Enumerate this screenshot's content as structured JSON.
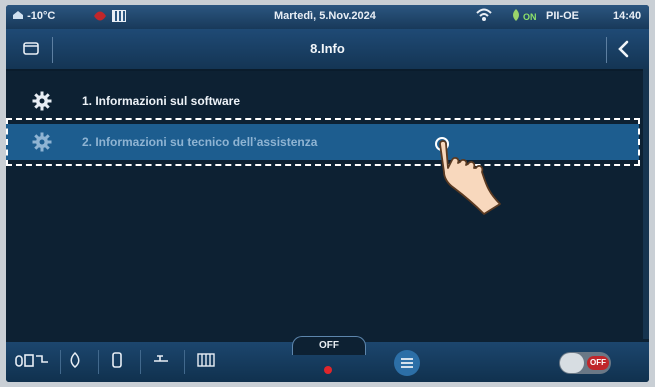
{
  "status_bar": {
    "temperature": "-10°C",
    "date": "Martedì, 5.Nov.2024",
    "on_label": "ON",
    "mode": "PII-OE",
    "time": "14:40"
  },
  "header": {
    "title": "8.Info"
  },
  "menu": {
    "items": [
      {
        "label": "1.  Informazioni sul software"
      },
      {
        "label": "2.  Informazioni su tecnico dell’assistenza"
      }
    ]
  },
  "bottom_bar": {
    "off_label": "OFF",
    "toggle_label": "OFF"
  },
  "colors": {
    "background": "#0d2133",
    "selected_row": "#1d5d8f",
    "accent_red": "#c0262a"
  }
}
